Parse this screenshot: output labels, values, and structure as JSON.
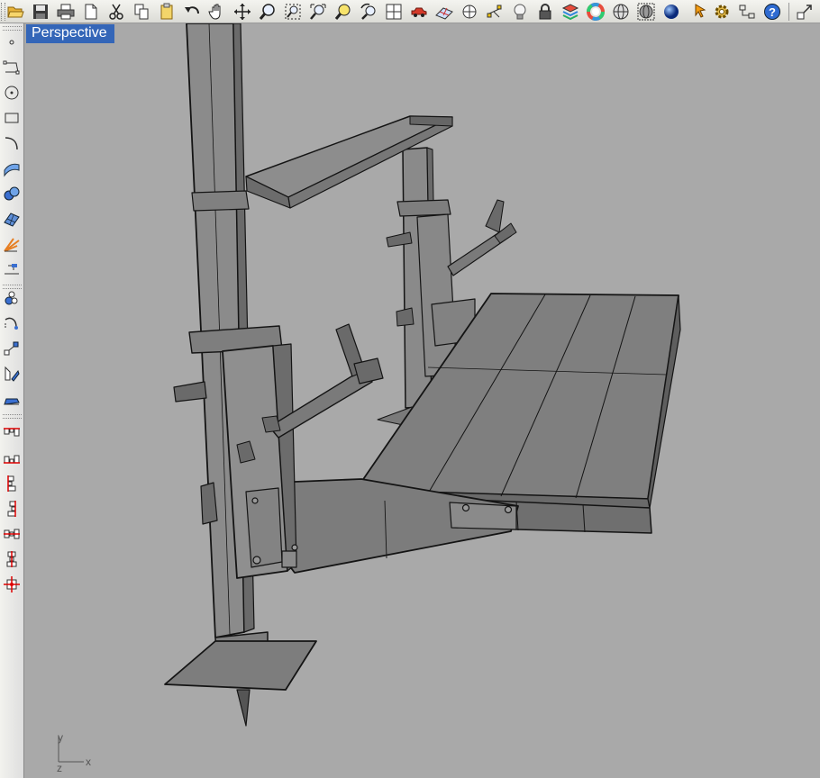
{
  "top_toolbar": {
    "buttons": [
      {
        "name": "open-button",
        "icon": "folder-open-icon"
      },
      {
        "name": "save-button",
        "icon": "floppy-disk-icon"
      },
      {
        "name": "print-button",
        "icon": "printer-icon"
      },
      {
        "name": "new-document-button",
        "icon": "document-icon"
      },
      {
        "name": "cut-button",
        "icon": "scissors-icon"
      },
      {
        "name": "copy-button",
        "icon": "copy-icon"
      },
      {
        "name": "paste-button",
        "icon": "clipboard-icon"
      },
      {
        "name": "undo-button",
        "icon": "undo-arrow-icon"
      },
      {
        "name": "pan-button",
        "icon": "hand-icon"
      },
      {
        "name": "rotate-view-button",
        "icon": "rotate-arrows-icon"
      },
      {
        "name": "zoom-button",
        "icon": "magnifier-icon"
      },
      {
        "name": "zoom-window-button",
        "icon": "zoom-window-icon"
      },
      {
        "name": "zoom-extents-button",
        "icon": "zoom-extents-icon"
      },
      {
        "name": "zoom-selected-button",
        "icon": "zoom-selected-icon"
      },
      {
        "name": "undo-view-button",
        "icon": "undo-view-icon"
      },
      {
        "name": "four-viewports-button",
        "icon": "grid-icon"
      },
      {
        "name": "set-cplane-button",
        "icon": "cplane-car-icon"
      },
      {
        "name": "grid-options-button",
        "icon": "grid-plane-icon"
      },
      {
        "name": "osnap-button",
        "icon": "target-icon"
      },
      {
        "name": "select-points-button",
        "icon": "points-icon"
      },
      {
        "name": "light-button",
        "icon": "lightbulb-icon"
      },
      {
        "name": "lock-button",
        "icon": "padlock-icon"
      },
      {
        "name": "layer-button",
        "icon": "layers-icon"
      },
      {
        "name": "color-button",
        "icon": "color-wheel-icon"
      },
      {
        "name": "wireframe-button",
        "icon": "wireframe-sphere-icon"
      },
      {
        "name": "shaded-button",
        "icon": "shaded-sphere-icon"
      },
      {
        "name": "render-button",
        "icon": "blue-sphere-icon"
      },
      {
        "name": "select-button",
        "icon": "arrow-cursor-icon"
      },
      {
        "name": "options-button",
        "icon": "gear-icon"
      },
      {
        "name": "properties-button",
        "icon": "properties-icon"
      },
      {
        "name": "help-button",
        "icon": "help-icon"
      },
      {
        "name": "expand-button",
        "icon": "expand-arrow-icon"
      }
    ]
  },
  "left_toolbar": {
    "buttons": [
      {
        "name": "point-tool",
        "icon": "point-icon"
      },
      {
        "name": "curve-tool",
        "icon": "polyline-icon"
      },
      {
        "name": "circle-tool",
        "icon": "circle-icon"
      },
      {
        "name": "rectangle-tool",
        "icon": "rectangle-icon"
      },
      {
        "name": "arc-tool",
        "icon": "arc-icon"
      },
      {
        "name": "surface-tool",
        "icon": "surface-icon"
      },
      {
        "name": "solid-tool",
        "icon": "spheres-icon"
      },
      {
        "name": "mesh-tool",
        "icon": "mesh-icon"
      },
      {
        "name": "explode-tool",
        "icon": "explode-icon"
      },
      {
        "name": "dimension-tool",
        "icon": "dimension-icon"
      },
      {
        "name": "group-tool",
        "icon": "group-icon"
      },
      {
        "name": "fillet-tool",
        "icon": "fillet-icon"
      },
      {
        "name": "move-tool",
        "icon": "move-icon"
      },
      {
        "name": "transform-tool",
        "icon": "transform-icon"
      },
      {
        "name": "analyze-tool",
        "icon": "analyze-icon"
      },
      {
        "name": "align-top-tool",
        "icon": "align-top-icon"
      },
      {
        "name": "align-bottom-tool",
        "icon": "align-bottom-icon"
      },
      {
        "name": "align-left-tool",
        "icon": "align-left-icon"
      },
      {
        "name": "align-right-tool",
        "icon": "align-right-icon"
      },
      {
        "name": "align-hcenter-tool",
        "icon": "align-hcenter-icon"
      },
      {
        "name": "align-vcenter-tool",
        "icon": "align-vcenter-icon"
      },
      {
        "name": "align-center-tool",
        "icon": "align-center-icon"
      }
    ]
  },
  "viewport": {
    "title": "Perspective",
    "axis": {
      "x": "x",
      "y": "y",
      "z": "z"
    }
  },
  "colors": {
    "viewport_background": "#a9a9a9",
    "title_background": "#3466b8",
    "model_face": "#7d7d7d",
    "model_edge": "#141414"
  }
}
